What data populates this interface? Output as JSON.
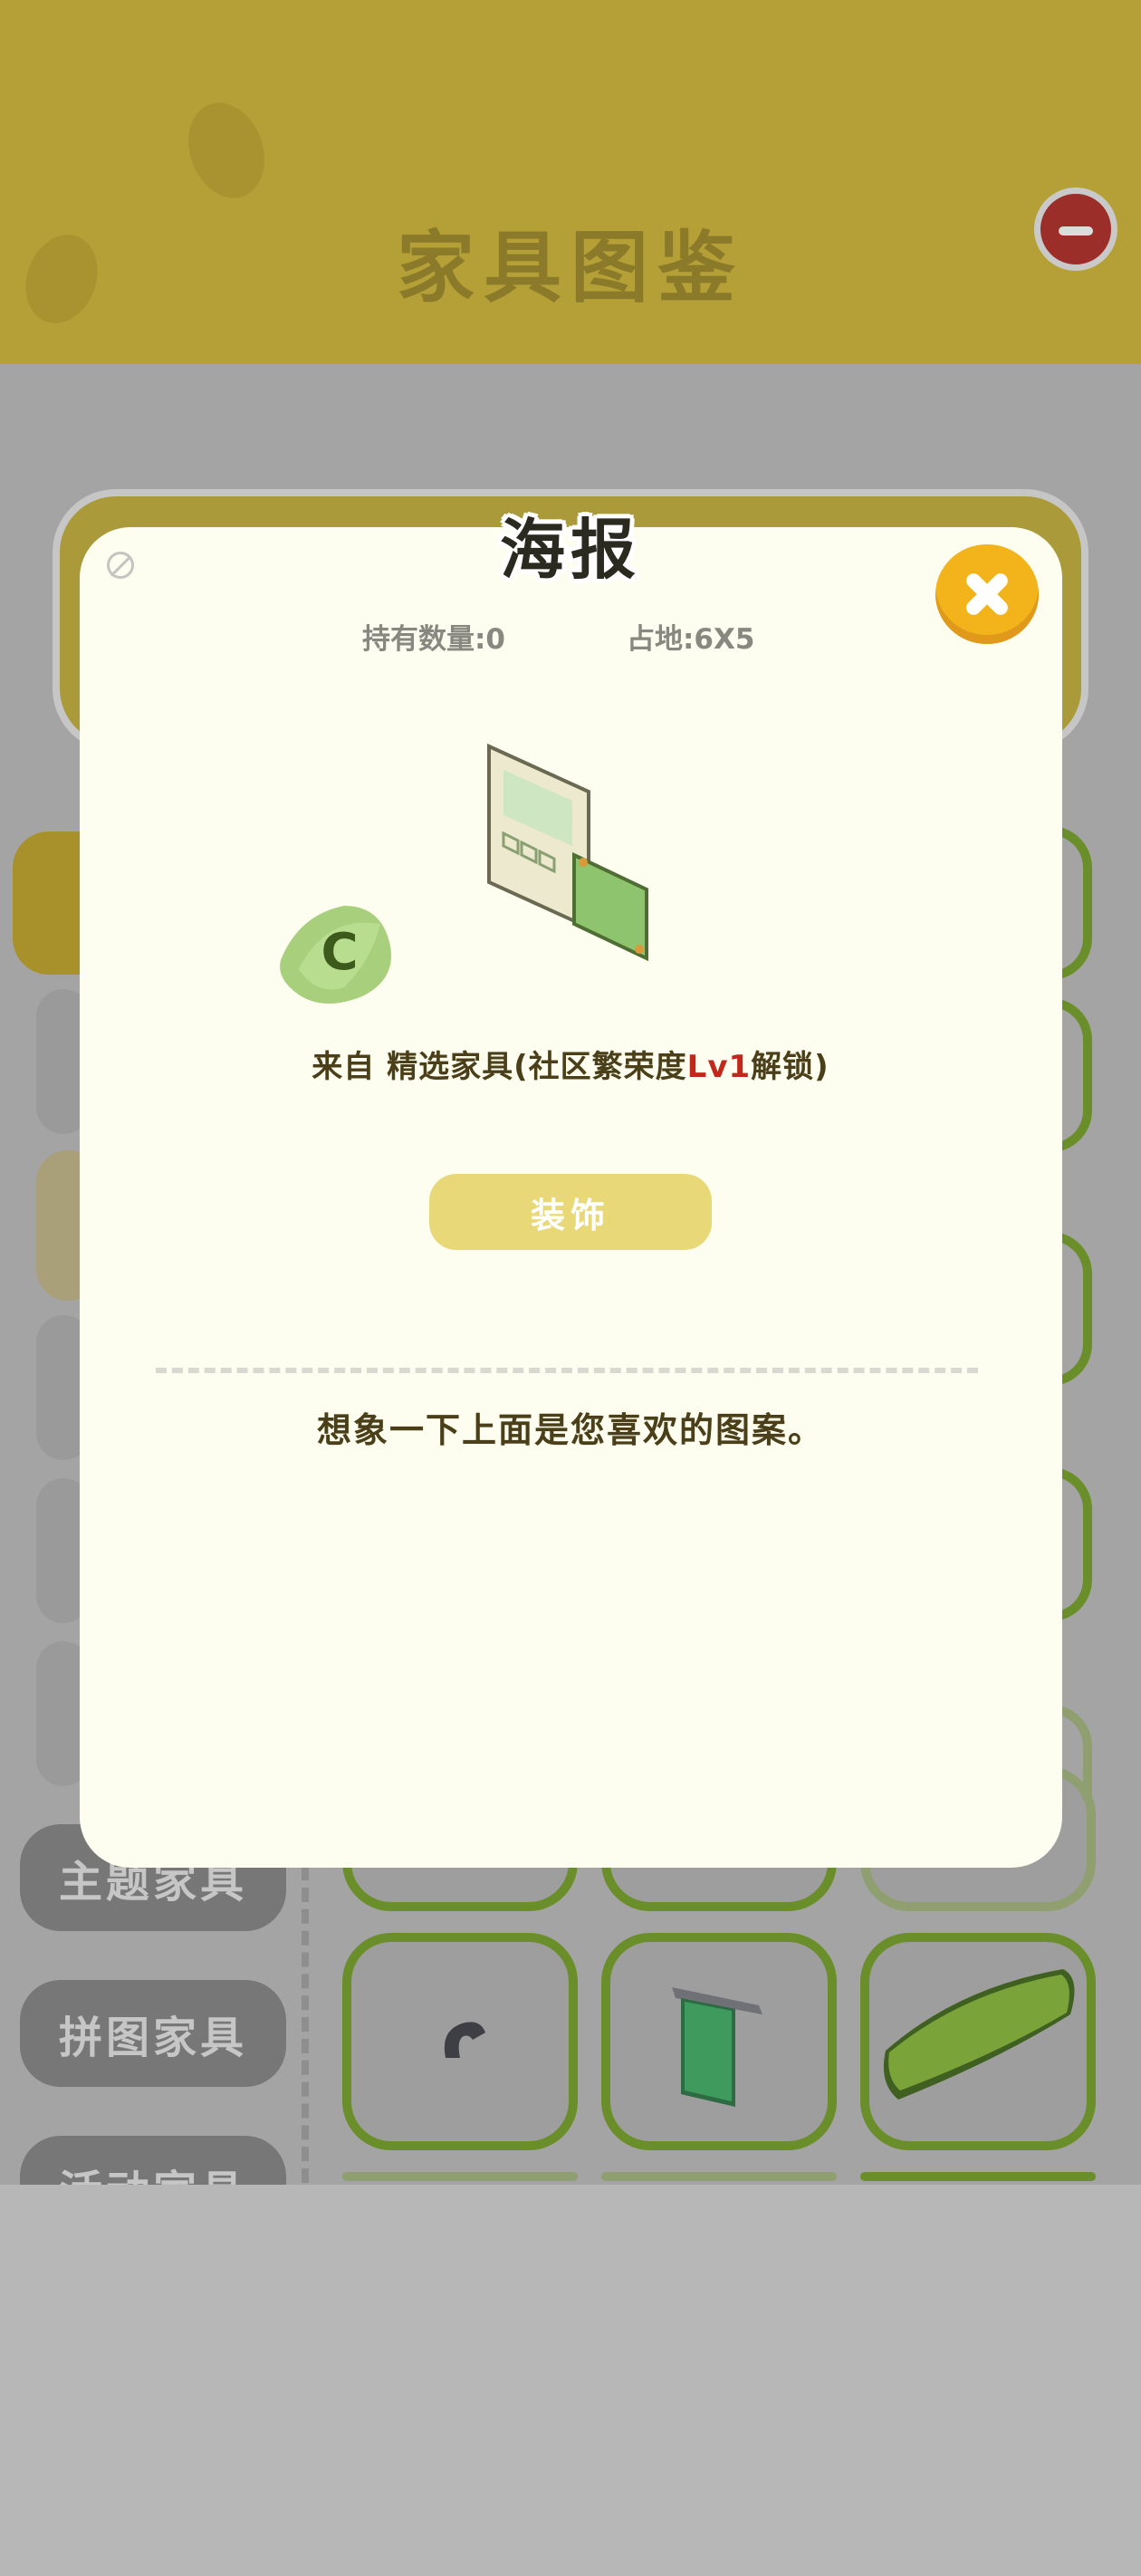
{
  "header": {
    "title": "家具图鉴"
  },
  "sidebar": {
    "tabs": [
      {
        "label": "主题家具"
      },
      {
        "label": "拼图家具"
      },
      {
        "label": "活动家具"
      }
    ]
  },
  "modal": {
    "title": "海报",
    "owned": "持有数量:0",
    "size": "占地:6X5",
    "source_prefix": "来自  精选家具(社区繁荣度",
    "source_level": "Lv1",
    "source_suffix": "解锁)",
    "rank": "C",
    "action_label": "装饰",
    "description": "想象一下上面是您喜欢的图案。"
  },
  "colors": {
    "header": "#b4a036",
    "modal_bg": "#fdfdf0",
    "close_button": "#f2b41a",
    "decor_button": "#e9d878",
    "level_text": "#c0281c",
    "tile_border": "#6a8f2a"
  },
  "icons": [
    "close-icon",
    "minus-icon",
    "block-icon",
    "poster-icon",
    "rank-badge-icon",
    "hook-icon",
    "towel-rack-icon",
    "cushion-icon"
  ]
}
